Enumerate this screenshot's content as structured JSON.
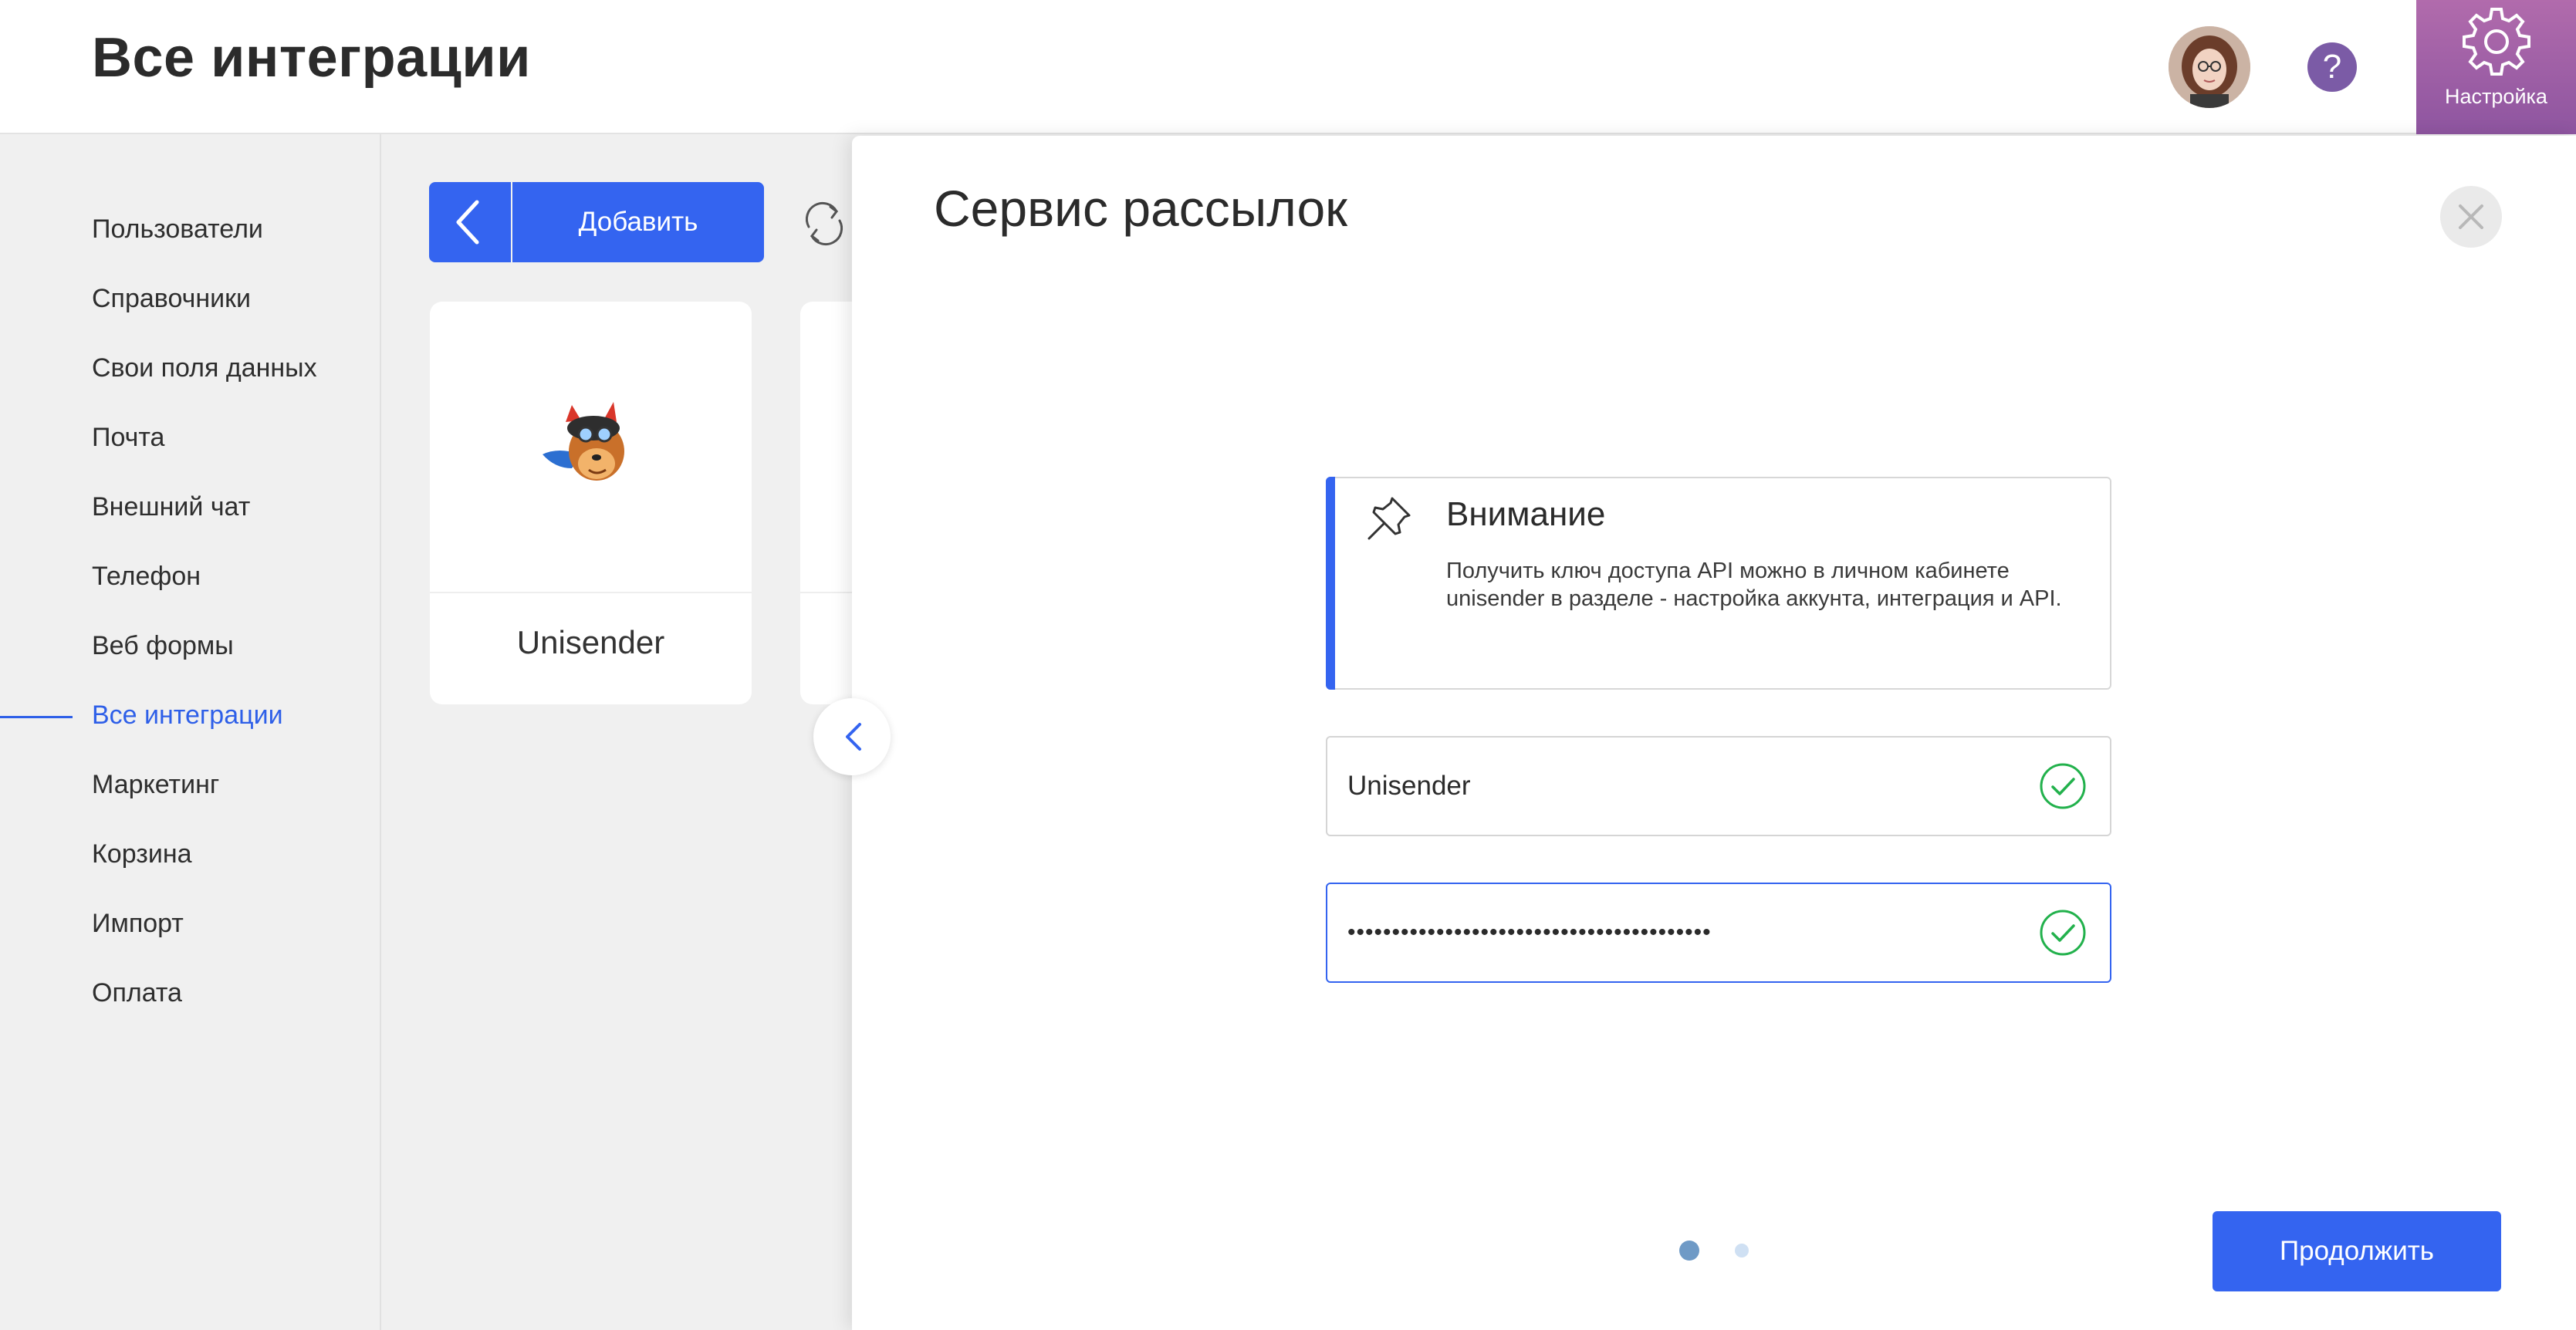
{
  "header": {
    "title": "Все интеграции",
    "help_label": "?",
    "settings_label": "Настройка"
  },
  "sidebar": {
    "items": [
      {
        "label": "Пользователи"
      },
      {
        "label": "Справочники"
      },
      {
        "label": "Свои поля данных"
      },
      {
        "label": "Почта"
      },
      {
        "label": "Внешний чат"
      },
      {
        "label": "Телефон"
      },
      {
        "label": "Веб формы"
      },
      {
        "label": "Все интеграции",
        "active": true
      },
      {
        "label": "Маркетинг"
      },
      {
        "label": "Корзина"
      },
      {
        "label": "Импорт"
      },
      {
        "label": "Оплата"
      }
    ]
  },
  "toolbar": {
    "add_label": "Добавить"
  },
  "cards": [
    {
      "label": "Unisender",
      "logo": "unisender-dog-logo"
    }
  ],
  "panel": {
    "title": "Сервис рассылок",
    "notice": {
      "title": "Внимание",
      "text": "Получить ключ доступа API можно в личном кабинете unisender в разделе - настройка аккунта, интеграция и API."
    },
    "fields": {
      "service_name": "Unisender",
      "api_key_masked": "•••••••••••••••••••••••••••••••••••••••••"
    },
    "steps": {
      "current": 1,
      "total": 2
    },
    "continue_label": "Продолжить"
  },
  "colors": {
    "accent": "#3464f0",
    "settings_bg": "#9b5fa8",
    "help_bg": "#7b5ba6",
    "success": "#22b14c"
  },
  "icons": [
    "gear-icon",
    "question-icon",
    "chevron-left-icon",
    "refresh-icon",
    "close-icon",
    "pin-icon",
    "check-circle-icon"
  ]
}
